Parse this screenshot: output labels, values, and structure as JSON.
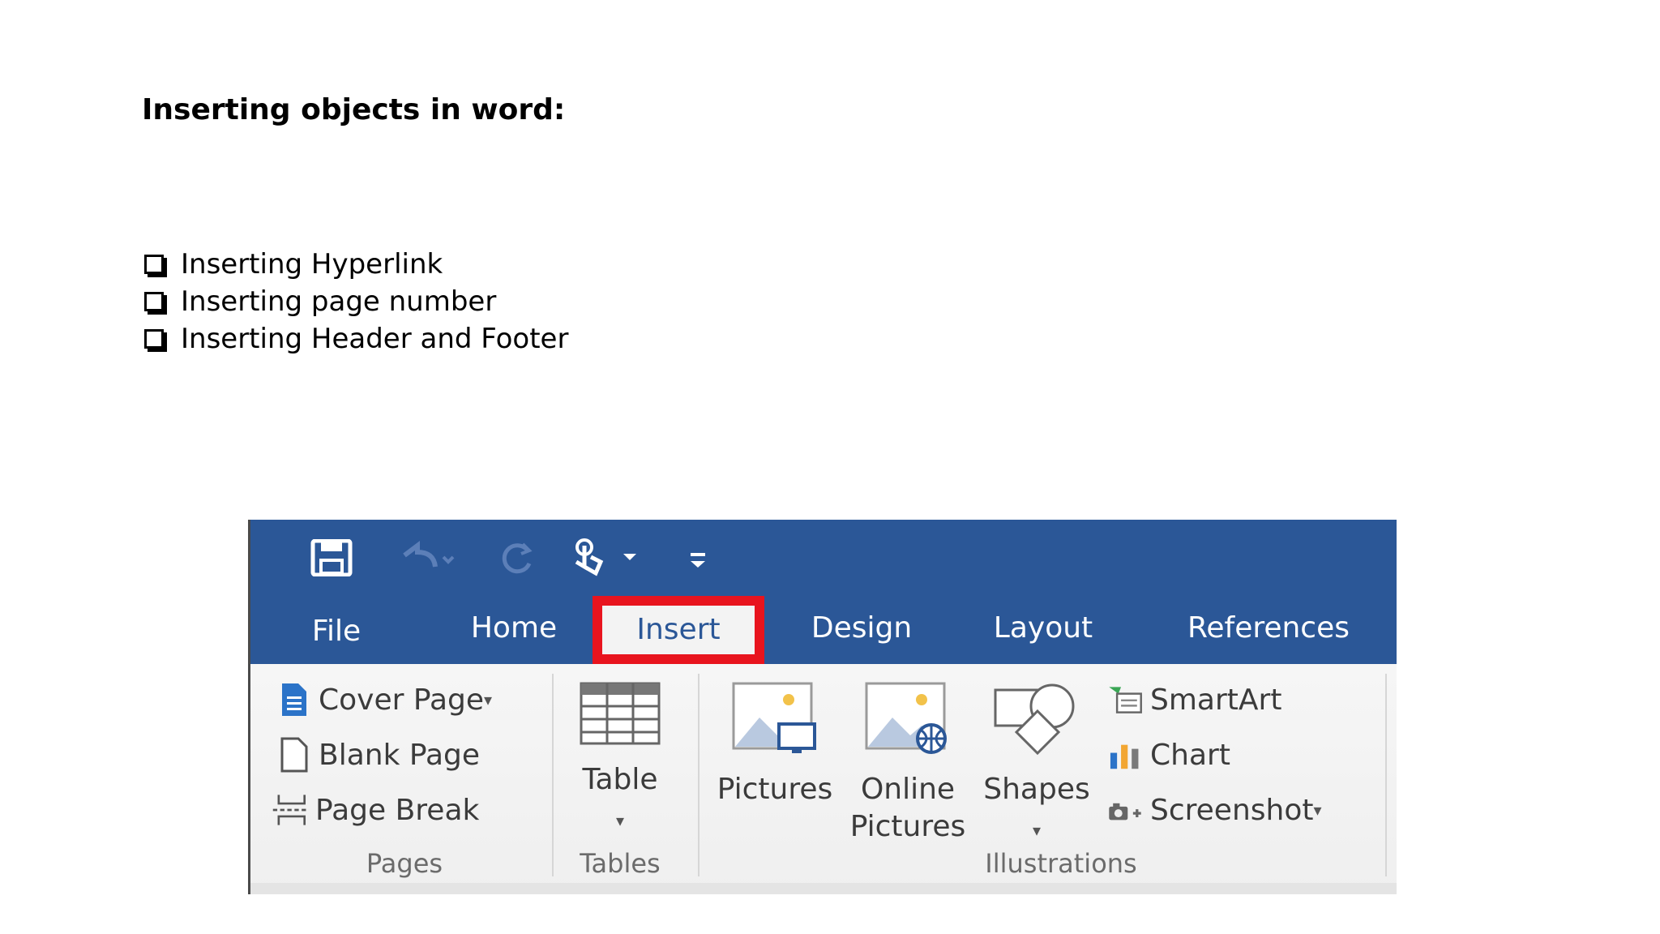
{
  "slide": {
    "title": "Inserting objects in word:",
    "bullets": [
      "Inserting Hyperlink",
      "Inserting page number",
      "Inserting Header and Footer"
    ]
  },
  "ribbon": {
    "tabs": [
      "File",
      "Home",
      "Insert",
      "Design",
      "Layout",
      "References"
    ],
    "active_tab": "Insert",
    "pages": {
      "items": [
        "Cover Page",
        "Blank Page",
        "Page Break"
      ],
      "label": "Pages"
    },
    "tables": {
      "item": "Table",
      "label": "Tables"
    },
    "illustrations": {
      "pictures": "Pictures",
      "online_line1": "Online",
      "online_line2": "Pictures",
      "shapes": "Shapes",
      "smartart": "SmartArt",
      "chart": "Chart",
      "screenshot": "Screenshot",
      "label": "Illustrations"
    },
    "colors": {
      "title_bar": "#2b5797",
      "highlight": "#e8141e",
      "ribbon_bg": "#f3f3f3"
    }
  }
}
